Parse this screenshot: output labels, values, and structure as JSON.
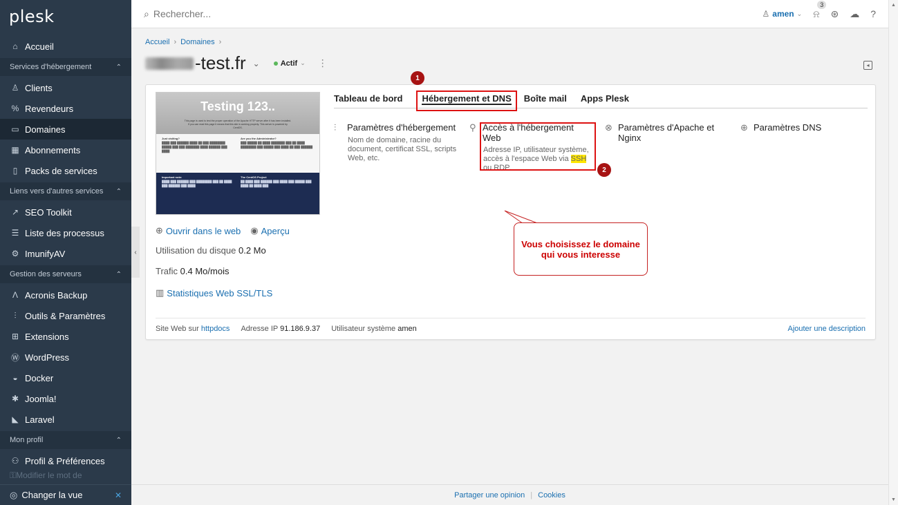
{
  "sidebar": {
    "logo": "plesk",
    "items": [
      {
        "label": "Accueil",
        "icon": "home-icon"
      },
      {
        "section": "Services d'hébergement"
      },
      {
        "label": "Clients",
        "icon": "user-icon"
      },
      {
        "label": "Revendeurs",
        "icon": "percent-icon"
      },
      {
        "label": "Domaines",
        "icon": "monitor-icon",
        "active": true
      },
      {
        "label": "Abonnements",
        "icon": "grid-icon"
      },
      {
        "label": "Packs de services",
        "icon": "book-icon"
      },
      {
        "section": "Liens vers d'autres services"
      },
      {
        "label": "SEO Toolkit",
        "icon": "chart-icon"
      },
      {
        "label": "Liste des processus",
        "icon": "list-icon"
      },
      {
        "label": "ImunifyAV",
        "icon": "gear-icon"
      },
      {
        "section": "Gestion des serveurs"
      },
      {
        "label": "Acronis Backup",
        "icon": "acronis-icon"
      },
      {
        "label": "Outils & Paramètres",
        "icon": "sliders-icon"
      },
      {
        "label": "Extensions",
        "icon": "extensions-icon"
      },
      {
        "label": "WordPress",
        "icon": "wordpress-icon"
      },
      {
        "label": "Docker",
        "icon": "docker-icon"
      },
      {
        "label": "Joomla!",
        "icon": "joomla-icon"
      },
      {
        "label": "Laravel",
        "icon": "laravel-icon"
      },
      {
        "section": "Mon profil"
      },
      {
        "label": "Profil & Préférences",
        "icon": "profile-icon"
      },
      {
        "label": "Modifier le mot de",
        "icon": "key-icon",
        "faded": true
      }
    ],
    "bottom_label": "Changer la vue"
  },
  "topbar": {
    "search_placeholder": "Rechercher...",
    "user": "amen",
    "notifications": "3"
  },
  "breadcrumb": [
    "Accueil",
    "Domaines"
  ],
  "domain": {
    "name_suffix": "-test.fr",
    "status": "Actif"
  },
  "thumbnail": {
    "title": "Testing 123..",
    "intro": "This page is used to test the proper operation of the Apache HTTP server after it has been installed. If you can read this page it means that this site is working properly. This server is powered by CentOS.",
    "col1_title": "Just visiting?",
    "col2_title": "Are you the Administrator?",
    "col3_title": "Important note:",
    "col4_title": "The CentOS Project"
  },
  "left": {
    "open_web": "Ouvrir dans le web",
    "preview": "Aperçu",
    "disk_label": "Utilisation du disque",
    "disk_value": "0.2 Mo",
    "traffic_label": "Trafic",
    "traffic_value": "0.4 Mo/mois",
    "stats": "Statistiques Web SSL/TLS"
  },
  "tabs": [
    "Tableau de bord",
    "Hébergement et DNS",
    "Boîte mail",
    "Apps Plesk"
  ],
  "features": [
    {
      "title": "Paramètres d'hébergement",
      "desc": "Nom de domaine, racine du document, certificat SSL, scripts Web, etc.",
      "icon": "sliders-icon"
    },
    {
      "title": "Accès à l'hébergement Web",
      "desc_pre": "Adresse IP, utilisateur système, accès à l'espace Web via ",
      "desc_ssh": "SSH",
      "desc_post": " ou RDP.",
      "icon": "wrench-icon"
    },
    {
      "title": "Paramètres d'Apache et Nginx",
      "icon": "apache-icon"
    },
    {
      "title": "Paramètres DNS",
      "icon": "globe-icon"
    }
  ],
  "annotations": {
    "one": "1",
    "two": "2",
    "bubble": "Vous choisissez le domaine qui vous interesse"
  },
  "card_footer": {
    "site_label": "Site Web sur",
    "site_value": "httpdocs",
    "ip_label": "Adresse IP",
    "ip_value": "91.186.9.37",
    "user_label": "Utilisateur système",
    "user_value": "amen",
    "add_desc": "Ajouter une description"
  },
  "page_footer": {
    "feedback": "Partager une opinion",
    "cookies": "Cookies"
  },
  "colors": {
    "sidebar_bg": "#2b3a4a",
    "link": "#1a6fb0",
    "annotation_red": "#d11111"
  }
}
